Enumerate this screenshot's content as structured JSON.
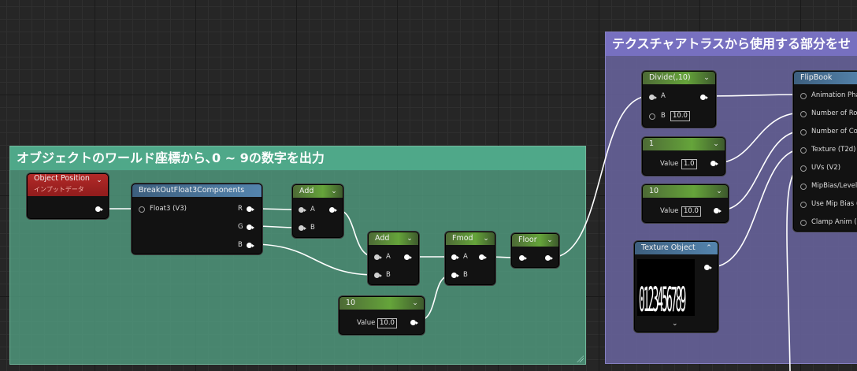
{
  "comments": {
    "world_digit": "オブジェクトのワールド座標から､0 ~ 9の数字を出力",
    "atlas_select": "テクスチャアトラスから使用する部分をせ"
  },
  "nodes": {
    "object_position": {
      "title": "Object Position",
      "subtitle": "インプットデータ"
    },
    "break_out": {
      "title": "BreakOutFloat3Components",
      "input": "Float3 (V3)",
      "outputs": [
        "R",
        "G",
        "B"
      ]
    },
    "add1": {
      "title": "Add",
      "pins": [
        "A",
        "B"
      ]
    },
    "add2": {
      "title": "Add",
      "pins": [
        "A",
        "B"
      ]
    },
    "fmod": {
      "title": "Fmod",
      "pins": [
        "A",
        "B"
      ]
    },
    "floor": {
      "title": "Floor"
    },
    "const10_left": {
      "title": "10",
      "label": "Value",
      "value": "10.0"
    },
    "divide": {
      "title": "Divide(,10)",
      "pin_a": "A",
      "pin_b": "B",
      "value_b": "10.0"
    },
    "const1": {
      "title": "1",
      "label": "Value",
      "value": "1.0"
    },
    "const10_right": {
      "title": "10",
      "label": "Value",
      "value": "10.0"
    },
    "texture_object": {
      "title": "Texture Object",
      "preview_text": "0123456789"
    },
    "flipbook": {
      "title": "FlipBook",
      "inputs": [
        "Animation Pha",
        "Number of Row",
        "Number of Colu",
        "Texture (T2d)",
        "UVs (V2)",
        "MipBias/Level",
        "Use Mip Bias (",
        "Clamp Anim (s"
      ]
    }
  },
  "colors": {
    "comment_green": "#4fa889",
    "comment_purple": "#7770c0",
    "header_green": "#65a43a",
    "header_blue": "#5484ad",
    "header_red": "#b32a28"
  }
}
